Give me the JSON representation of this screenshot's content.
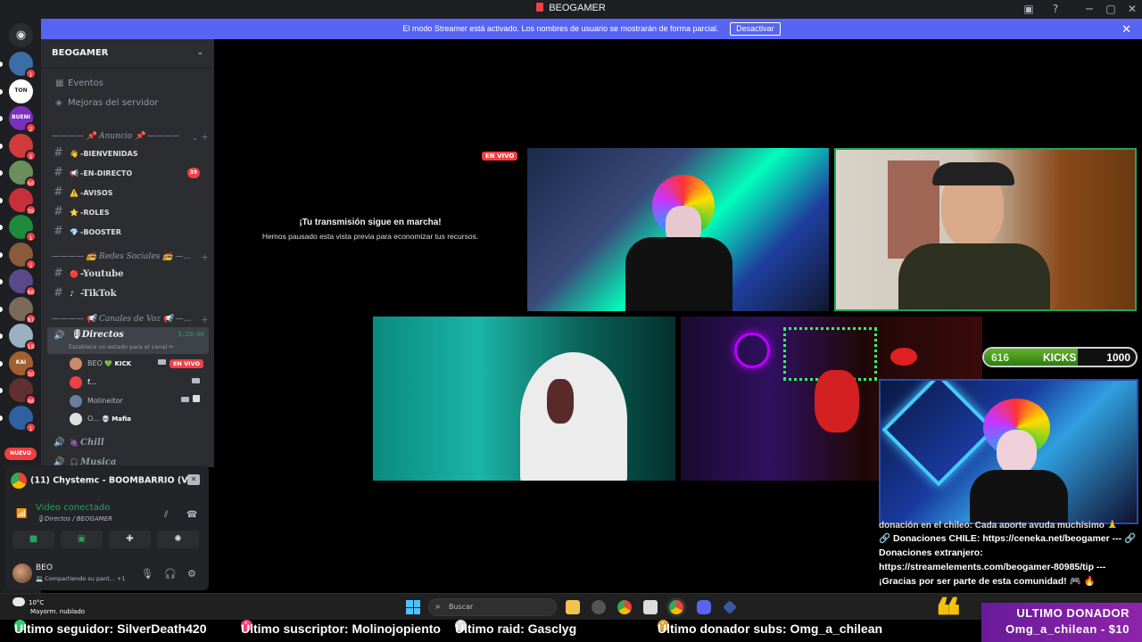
{
  "window": {
    "title": "BEOGAMER"
  },
  "banner": {
    "text": "El modo Streamer está activado. Los nombres de usuario se mostrarán de forma parcial.",
    "button": "Desactivar"
  },
  "rail": {
    "servers": [
      {
        "badge": "1",
        "color": "#3a6ea5"
      },
      {
        "badge": "",
        "color": "#ffffff",
        "label": "TON"
      },
      {
        "badge": "2",
        "color": "#7b2fbe",
        "label": "BUENI"
      },
      {
        "badge": "5",
        "color": "#d13b3b"
      },
      {
        "badge": "66",
        "color": "#6b8f5b"
      },
      {
        "badge": "39",
        "color": "#c7303a"
      },
      {
        "badge": "1",
        "color": "#1e8a3c"
      },
      {
        "badge": "5",
        "color": "#8a5a3a"
      },
      {
        "badge": "86",
        "color": "#5a4a8a"
      },
      {
        "badge": "87",
        "color": "#7a6a5a"
      },
      {
        "badge": "18",
        "color": "#9ab0c0"
      },
      {
        "badge": "30",
        "color": "#a06030",
        "label": "KAI"
      },
      {
        "badge": "46",
        "color": "#603030"
      },
      {
        "badge": "1",
        "color": "#3060a0"
      }
    ],
    "nuevo": "NUEVO"
  },
  "sidebar": {
    "server_name": "BEOGAMER",
    "top_items": [
      {
        "label": "Eventos",
        "icon": "calendar-icon"
      },
      {
        "label": "Mejoras del servidor",
        "icon": "boost-icon"
      }
    ],
    "cat_anuncio": "———— 📌 Anuncio 📌 ————",
    "channels": [
      {
        "emoji": "👋",
        "label": "-BIENVENIDAS",
        "count": ""
      },
      {
        "emoji": "📢",
        "label": "-EN-DIRECTO",
        "count": "39"
      },
      {
        "emoji": "⚠️",
        "label": "-AVISOS",
        "count": ""
      },
      {
        "emoji": "⭐",
        "label": "-ROLES",
        "count": ""
      },
      {
        "emoji": "💎",
        "label": "-BOOSTER",
        "count": ""
      }
    ],
    "cat_redes": "———— 📻 Redes Sociales 📻 —...",
    "redes": [
      {
        "emoji": "🔴",
        "label": "-Youtube"
      },
      {
        "emoji": "♪",
        "label": "-TikTok"
      }
    ],
    "cat_voz": "———— 📢 Canales de Voz 📢 —...",
    "voice_channel": {
      "name": "🎙Directos",
      "time": "5:20:00",
      "status": "Establece un estado para el canal ✏"
    },
    "voice_users": [
      {
        "name": "BEO",
        "tag": "💚 KICK",
        "live": "EN VIVO",
        "color": "#c98a6a"
      },
      {
        "name": "f...",
        "tag": "",
        "live": "",
        "color": "#f23f43"
      },
      {
        "name": "Molineitor",
        "tag": "",
        "live": "",
        "color": "#6a7fa0"
      },
      {
        "name": "O...",
        "tag": "💀 Mafia",
        "live": "",
        "color": "#e0e0e0"
      }
    ],
    "more_channels": [
      {
        "emoji": "🍇",
        "label": "Chill"
      },
      {
        "emoji": "🎧",
        "label": "Musica"
      }
    ]
  },
  "voice_panel": {
    "activity": "(11) Chystemc - BOOMBARRIO (V...",
    "connected": "Video conectado",
    "location": "🎙Directos / BEOGAMER",
    "user_name": "BEO",
    "user_status": "💻 Compartiendo su pant... +1"
  },
  "stage": {
    "paused_title": "¡Tu transmisión sigue en marcha!",
    "paused_sub": "Hemos pausado esta vista previa para economizar tus recursos.",
    "live_badge": "EN VIVO"
  },
  "overlay": {
    "kicks_left": "616",
    "kicks_label": "KICKS",
    "kicks_right": "1000",
    "kicks_progress": 0.616,
    "donate_cut": "donación en el chileo: Cada aporte ayuda muchísimo 🙏",
    "donate_lines": [
      "🔗 Donaciones CHILE: https://ceneka.net/beogamer --- 🔗",
      "Donaciones extranjero:",
      "https://streamelements.com/beogamer-80985/tip ---",
      "¡Gracias por ser parte de esta comunidad! 🎮 🔥"
    ]
  },
  "taskbar": {
    "temp": "10°C",
    "weather": "Mayorm. nublado",
    "search": "Buscar"
  },
  "ticker": {
    "follower": "Ultimo seguidor: SilverDeath420",
    "sub": "Último suscriptor: Molinojopiento",
    "raid": "Último raid: Gasclyg",
    "donor_subs": "Último donador subs: Omg_a_chilean",
    "donor_title": "ULTIMO DONADOR",
    "donor_value": "Omg_a_chilean - $10"
  },
  "colors": {
    "discord_blurple": "#5865f2",
    "online_green": "#23a55a",
    "danger_red": "#f23f43",
    "donor_purple": "#8e24aa"
  }
}
